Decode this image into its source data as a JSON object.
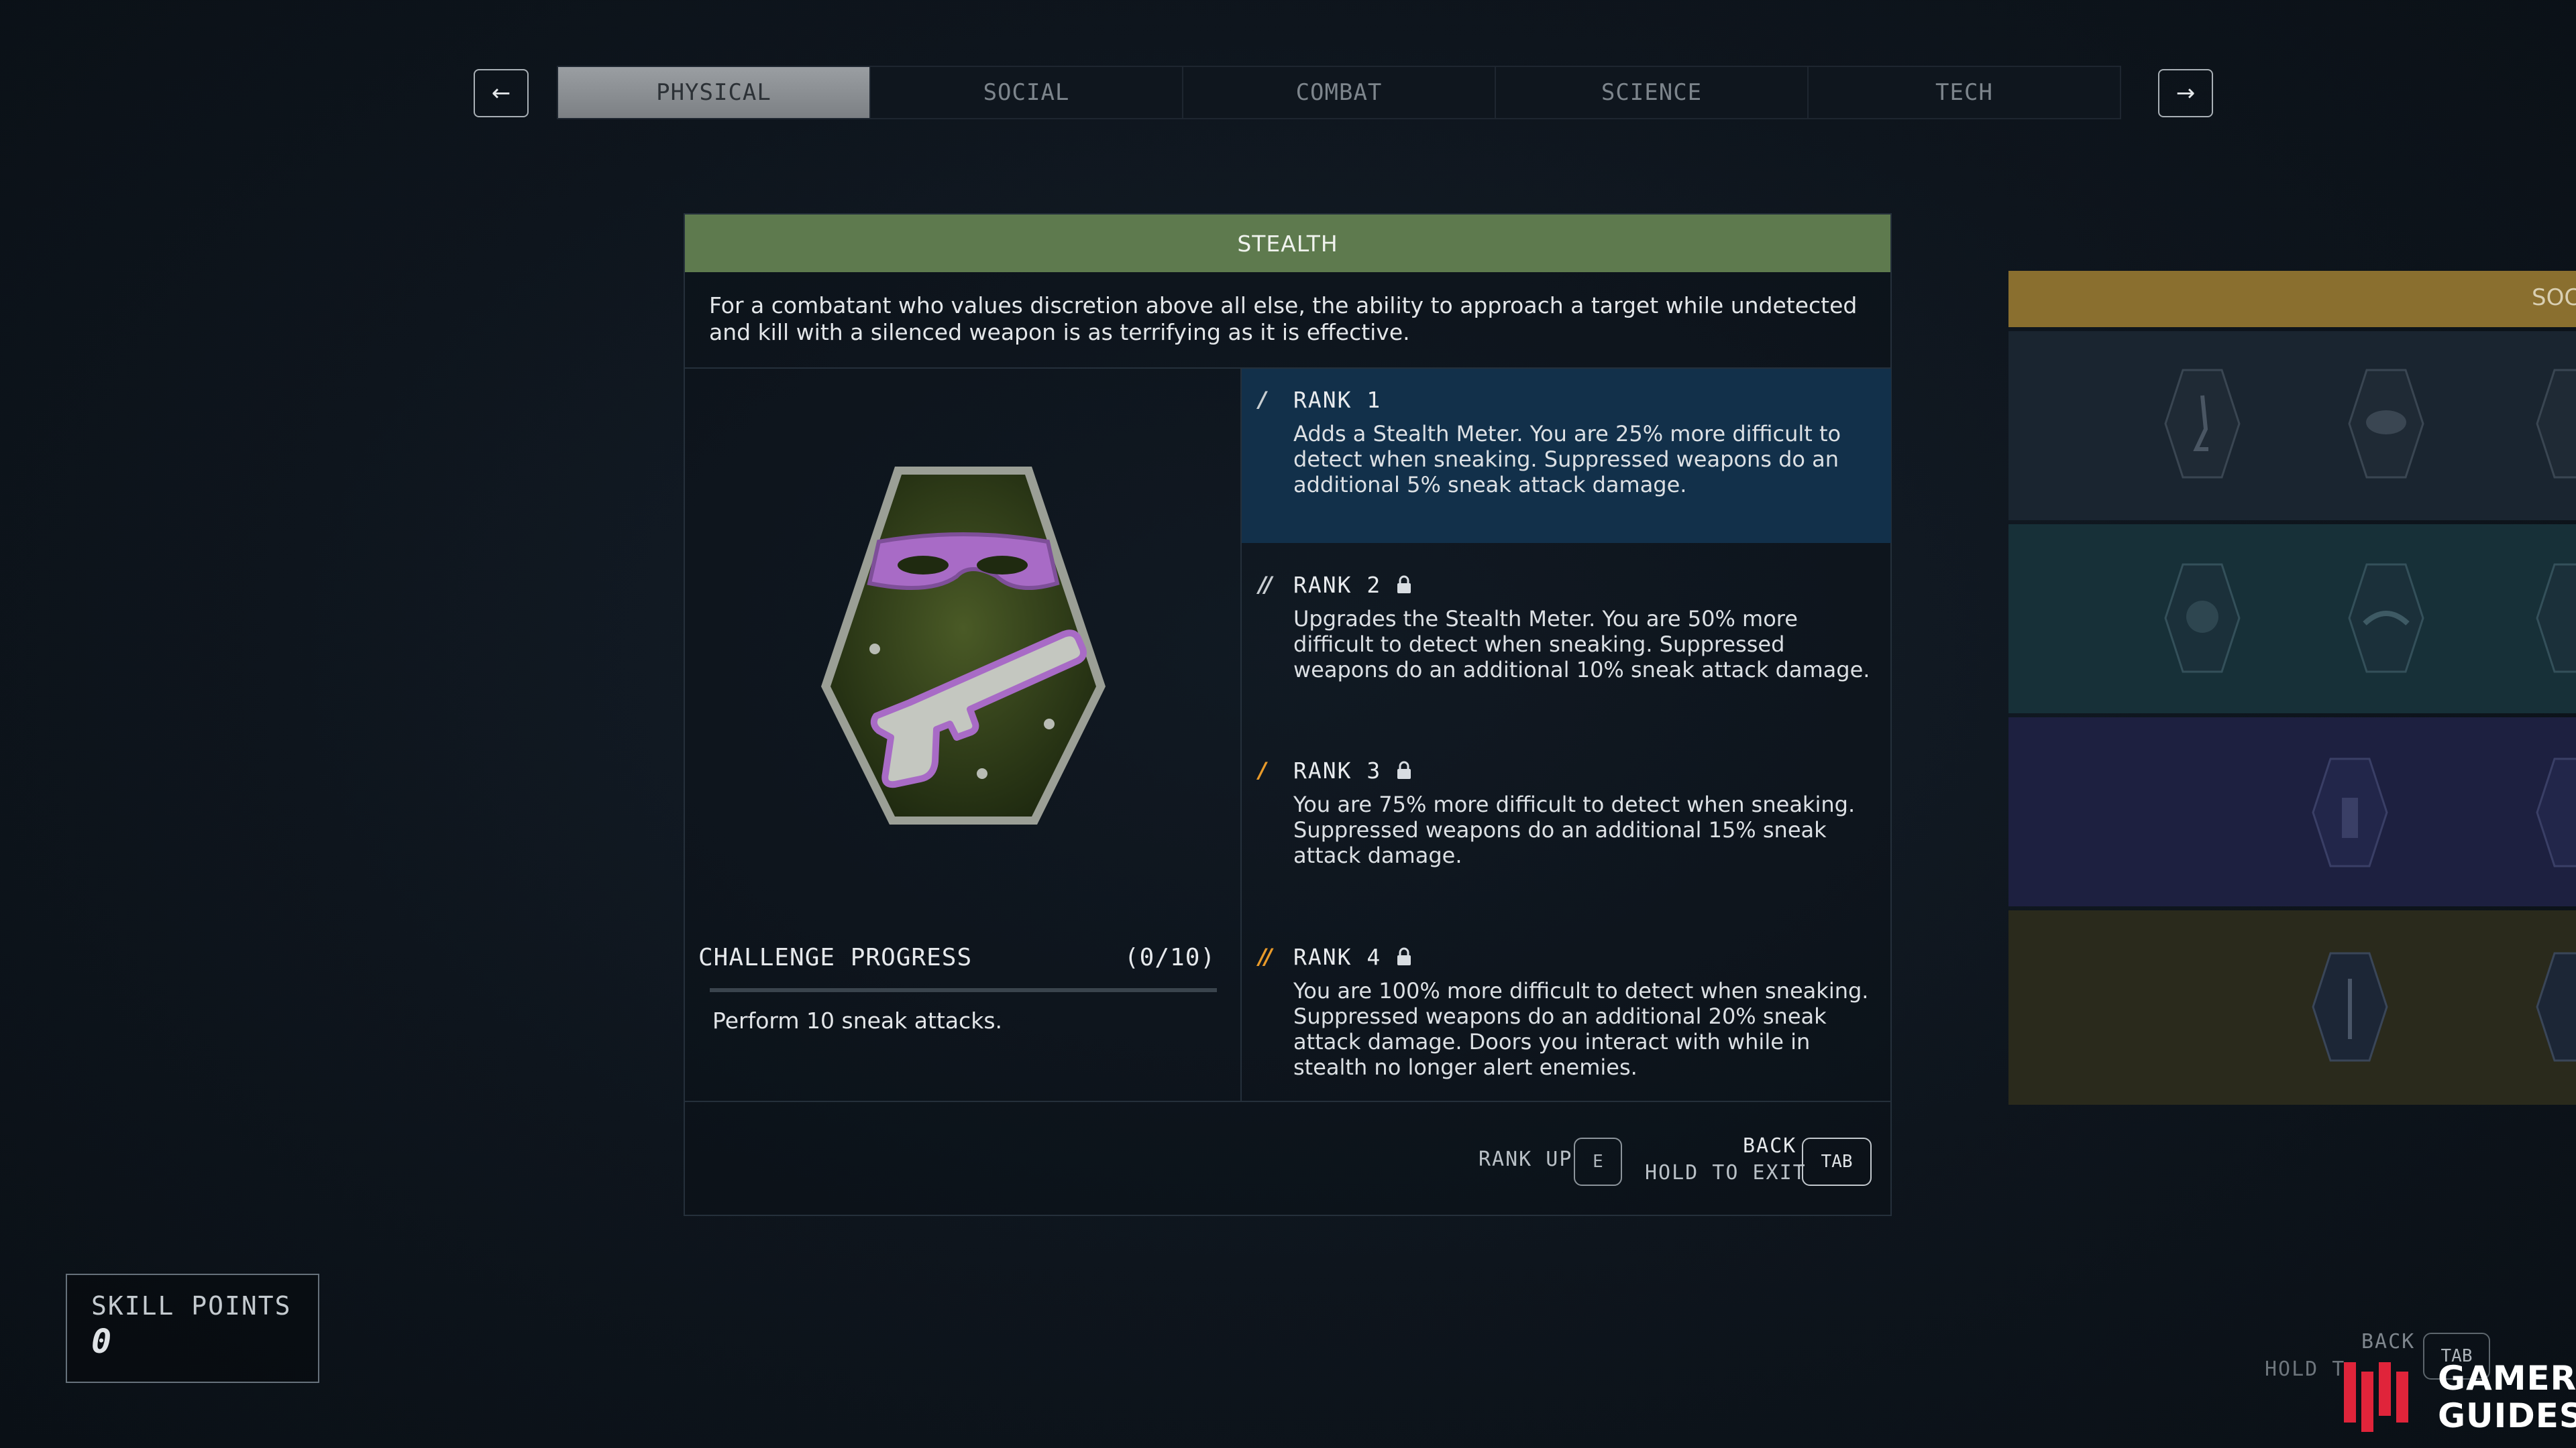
{
  "nav": {
    "prev_icon": "←",
    "next_icon": "→"
  },
  "tabs": [
    {
      "label": "PHYSICAL",
      "active": true
    },
    {
      "label": "SOCIAL",
      "active": false
    },
    {
      "label": "COMBAT",
      "active": false
    },
    {
      "label": "SCIENCE",
      "active": false
    },
    {
      "label": "TECH",
      "active": false
    }
  ],
  "skill": {
    "name": "STEALTH",
    "category_color": "#5e7a4e",
    "description": "For a combatant who values discretion above all else, the ability to approach a target while undetected and kill with a silenced weapon is as terrifying as it is effective.",
    "icon": "masked-pistol-patch-icon"
  },
  "challenge": {
    "title": "CHALLENGE PROGRESS",
    "count": "(0/10)",
    "progress": 0,
    "text": "Perform 10 sneak attacks."
  },
  "ranks": [
    {
      "label": "RANK 1",
      "marks": "/",
      "mark_color": "#c9ced2",
      "locked": false,
      "selected": true,
      "description": "Adds a Stealth Meter. You are 25% more difficult to detect when sneaking. Suppressed weapons do an additional 5% sneak attack damage."
    },
    {
      "label": "RANK 2",
      "marks": "//",
      "mark_color": "#c9ced2",
      "locked": true,
      "selected": false,
      "description": "Upgrades the Stealth Meter. You are 50% more difficult to detect when sneaking. Suppressed weapons do an additional 10% sneak attack damage."
    },
    {
      "label": "RANK 3",
      "marks": "/",
      "mark_color": "#e89a2a",
      "locked": true,
      "selected": false,
      "description": "You are 75% more difficult to detect when sneaking. Suppressed weapons do an additional 15% sneak attack damage."
    },
    {
      "label": "RANK 4",
      "marks": "//",
      "mark_color": "#e89a2a",
      "locked": true,
      "selected": false,
      "description": "You are 100% more difficult to detect when sneaking. Suppressed weapons do an additional 20% sneak attack damage. Doors you interact with while in stealth no longer alert enemies."
    }
  ],
  "footer": {
    "rank_up_label": "RANK UP",
    "rank_up_key": "E",
    "back_label": "BACK",
    "hold_exit_label": "HOLD TO EXIT",
    "back_key": "TAB"
  },
  "skill_points": {
    "label": "SKILL POINTS",
    "value": "0"
  },
  "right_preview": {
    "header_text": "SOCI",
    "header_color": "#8a6f2f",
    "row_colors": [
      "#1a2530",
      "#173038",
      "#1d2040",
      "#2a2a1c"
    ]
  },
  "watermark": {
    "back_label": "BACK",
    "hold_label": "HOLD T",
    "key": "TAB",
    "brand_line1": "GAMER",
    "brand_line2": "GUIDES"
  }
}
